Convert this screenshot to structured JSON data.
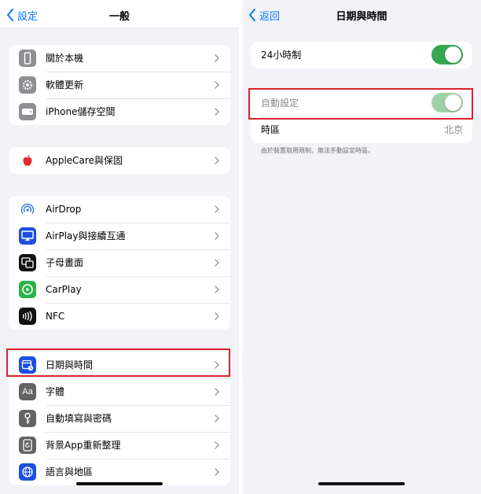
{
  "left": {
    "nav": {
      "back_label": "設定",
      "title": "一般"
    },
    "groups": [
      {
        "items": [
          {
            "label": "關於本機",
            "icon": "phone-icon"
          },
          {
            "label": "軟體更新",
            "icon": "gear-icon"
          },
          {
            "label": "iPhone儲存空間",
            "icon": "storage-icon"
          }
        ]
      },
      {
        "items": [
          {
            "label": "AppleCare與保固",
            "icon": "apple-icon"
          }
        ]
      },
      {
        "items": [
          {
            "label": "AirDrop",
            "icon": "airdrop-icon"
          },
          {
            "label": "AirPlay與接續互通",
            "icon": "airplay-icon"
          },
          {
            "label": "子母畫面",
            "icon": "picture-in-picture-icon"
          },
          {
            "label": "CarPlay",
            "icon": "carplay-icon"
          },
          {
            "label": "NFC",
            "icon": "nfc-icon"
          }
        ]
      },
      {
        "items": [
          {
            "label": "日期與時間",
            "icon": "date-time-icon"
          },
          {
            "label": "字體",
            "icon": "fonts-icon",
            "icon_text": "Aa"
          },
          {
            "label": "自動填寫與密碼",
            "icon": "key-icon"
          },
          {
            "label": "背景App重新整理",
            "icon": "refresh-icon"
          },
          {
            "label": "語言與地區",
            "icon": "globe-icon"
          }
        ]
      }
    ]
  },
  "right": {
    "nav": {
      "back_label": "返回",
      "title": "日期與時間"
    },
    "hour24": {
      "label": "24小時制",
      "on": true
    },
    "auto_set": {
      "label": "自動設定",
      "on": true,
      "disabled": true
    },
    "timezone": {
      "label": "時區",
      "value": "北京"
    },
    "footnote": "由於裝置取用限制，無法手動設定時區。"
  },
  "colors": {
    "accent": "#007aff",
    "toggle_on": "#34a852",
    "toggle_disabled": "#9fd1a6",
    "highlight": "#d9232e",
    "background": "#f2f2f7"
  }
}
